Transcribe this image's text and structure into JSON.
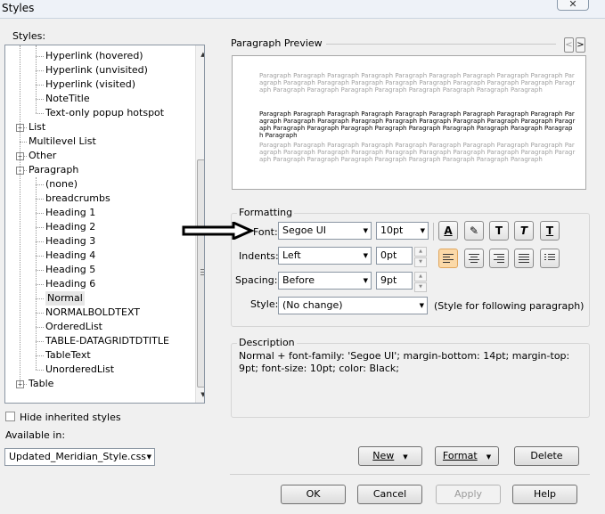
{
  "window": {
    "title": "Styles",
    "close_glyph": "✕"
  },
  "styles_label": "Styles:",
  "tree": {
    "items": [
      {
        "label": "Hyperlink (hovered)",
        "level": 2
      },
      {
        "label": "Hyperlink (unvisited)",
        "level": 2
      },
      {
        "label": "Hyperlink (visited)",
        "level": 2
      },
      {
        "label": "NoteTitle",
        "level": 2
      },
      {
        "label": "Text-only popup hotspot",
        "level": 2
      },
      {
        "label": "List",
        "level": 1,
        "expander": "+"
      },
      {
        "label": "Multilevel List",
        "level": 1
      },
      {
        "label": "Other",
        "level": 1,
        "expander": "+"
      },
      {
        "label": "Paragraph",
        "level": 1,
        "expander": "-"
      },
      {
        "label": "(none)",
        "level": 2
      },
      {
        "label": "breadcrumbs",
        "level": 2
      },
      {
        "label": "Heading 1",
        "level": 2
      },
      {
        "label": "Heading 2",
        "level": 2
      },
      {
        "label": "Heading 3",
        "level": 2
      },
      {
        "label": "Heading 4",
        "level": 2
      },
      {
        "label": "Heading 5",
        "level": 2
      },
      {
        "label": "Heading 6",
        "level": 2
      },
      {
        "label": "Normal",
        "level": 2,
        "selected": true
      },
      {
        "label": "NORMALBOLDTEXT",
        "level": 2
      },
      {
        "label": "OrderedList",
        "level": 2
      },
      {
        "label": "TABLE-DATAGRIDTDTITLE",
        "level": 2
      },
      {
        "label": "TableText",
        "level": 2
      },
      {
        "label": "UnorderedList",
        "level": 2
      },
      {
        "label": "Table",
        "level": 1,
        "expander": "+"
      }
    ]
  },
  "hide_inherited": {
    "label": "Hide inherited styles",
    "checked": false
  },
  "available_in": {
    "label": "Available in:",
    "value": "Updated_Meridian_Style.css"
  },
  "preview": {
    "title": "Paragraph Preview",
    "prev_glyph": "<",
    "next_glyph": ">",
    "grey_text": "Paragraph Paragraph Paragraph Paragraph Paragraph Paragraph Paragraph Paragraph Paragraph Paragraph Paragraph Paragraph Paragraph Paragraph Paragraph Paragraph Paragraph Paragraph Paragraph Paragraph Paragraph Paragraph Paragraph Paragraph Paragraph Paragraph Paragraph",
    "main_text": "Paragraph Paragraph Paragraph Paragraph Paragraph Paragraph Paragraph Paragraph Paragraph Paragraph Paragraph Paragraph Paragraph Paragraph Paragraph Paragraph Paragraph Paragraph Paragraph Paragraph Paragraph Paragraph Paragraph Paragraph Paragraph Paragraph Paragraph Paragraph Paragraph",
    "grey_text_2": "Paragraph Paragraph Paragraph Paragraph Paragraph Paragraph Paragraph Paragraph Paragraph Paragraph Paragraph Paragraph Paragraph Paragraph Paragraph Paragraph Paragraph Paragraph Paragraph Paragraph Paragraph Paragraph Paragraph Paragraph Paragraph Paragraph Paragraph"
  },
  "formatting": {
    "title": "Formatting",
    "font_label": "Font:",
    "font_value": "Segoe UI",
    "size_value": "10pt",
    "indents_label": "Indents:",
    "indents_value": "Left",
    "indents_amount": "0pt",
    "spacing_label": "Spacing:",
    "spacing_value": "Before",
    "spacing_amount": "9pt",
    "style_label": "Style:",
    "style_value": "(No change)",
    "style_note": "(Style for following paragraph)",
    "tool_glyphs": {
      "font_color": "A",
      "highlight": "✎",
      "bold": "T",
      "italic": "T",
      "underline": "T"
    }
  },
  "description": {
    "title": "Description",
    "text": "Normal + font-family: 'Segoe UI'; margin-bottom: 14pt; margin-top: 9pt; font-size: 10pt; color: Black;"
  },
  "buttons": {
    "new": "New",
    "format": "Format",
    "delete": "Delete",
    "ok": "OK",
    "cancel": "Cancel",
    "apply": "Apply",
    "help": "Help"
  },
  "glyphs": {
    "dropdown": "▼",
    "spin_up": "▲",
    "spin_down": "▼",
    "scroll_up": "▲",
    "scroll_down": "▼"
  }
}
